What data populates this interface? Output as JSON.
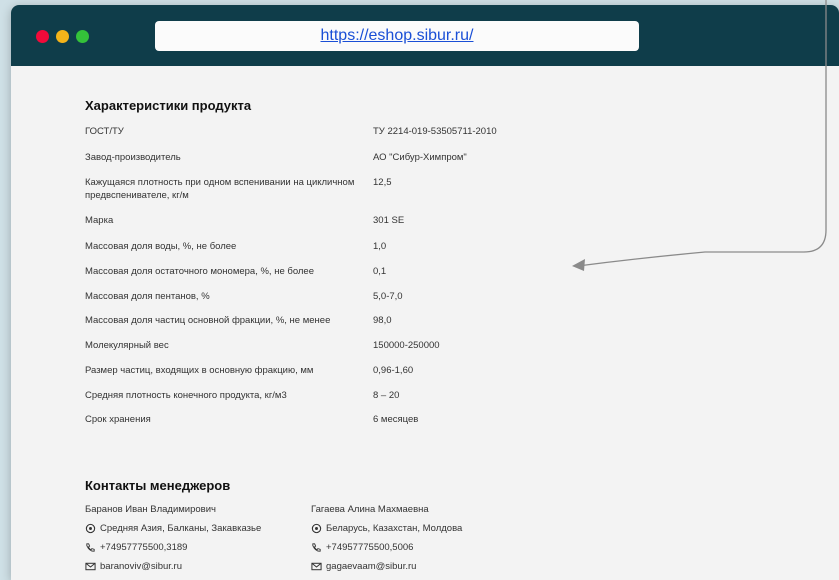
{
  "browser": {
    "url": "https://eshop.sibur.ru/"
  },
  "specs": {
    "title": "Характеристики продукта",
    "rows": [
      {
        "label": "ГОСТ/ТУ",
        "value": "ТУ 2214-019-53505711-2010"
      },
      {
        "label": "Завод-производитель",
        "value": "АО \"Сибур-Химпром\""
      },
      {
        "label": "Кажущаяся плотность при одном вспенивании на цикличном предвспенивателе, кг/м",
        "value": "12,5"
      },
      {
        "label": "Марка",
        "value": "301 SE"
      },
      {
        "label": "Массовая доля воды, %, не более",
        "value": "1,0"
      },
      {
        "label": "Массовая доля остаточного мономера, %, не более",
        "value": "0,1"
      },
      {
        "label": "Массовая доля пентанов, %",
        "value": "5,0-7,0"
      },
      {
        "label": "Массовая доля частиц основной фракции, %, не менее",
        "value": "98,0"
      },
      {
        "label": "Молекулярный вес",
        "value": "150000-250000"
      },
      {
        "label": "Размер частиц, входящих в основную фракцию, мм",
        "value": "0,96-1,60"
      },
      {
        "label": "Средняя плотность конечного продукта, кг/м3",
        "value": "8 – 20"
      },
      {
        "label": "Срок хранения",
        "value": "6 месяцев"
      }
    ]
  },
  "managers": {
    "title": "Контакты менеджеров",
    "list": [
      {
        "name": "Баранов Иван Владимирович",
        "region": "Средняя Азия, Балканы, Закавказье",
        "phone": "+74957775500,3189",
        "email": "baranoviv@sibur.ru"
      },
      {
        "name": "Гагаева Алина Махмаевна",
        "region": "Беларусь, Казахстан, Молдова",
        "phone": "+74957775500,5006",
        "email": "gagaevaam@sibur.ru"
      }
    ]
  },
  "colors": {
    "titlebar": "#0f3d4a",
    "link": "#1a4fd6",
    "background": "#cfe0e6"
  }
}
